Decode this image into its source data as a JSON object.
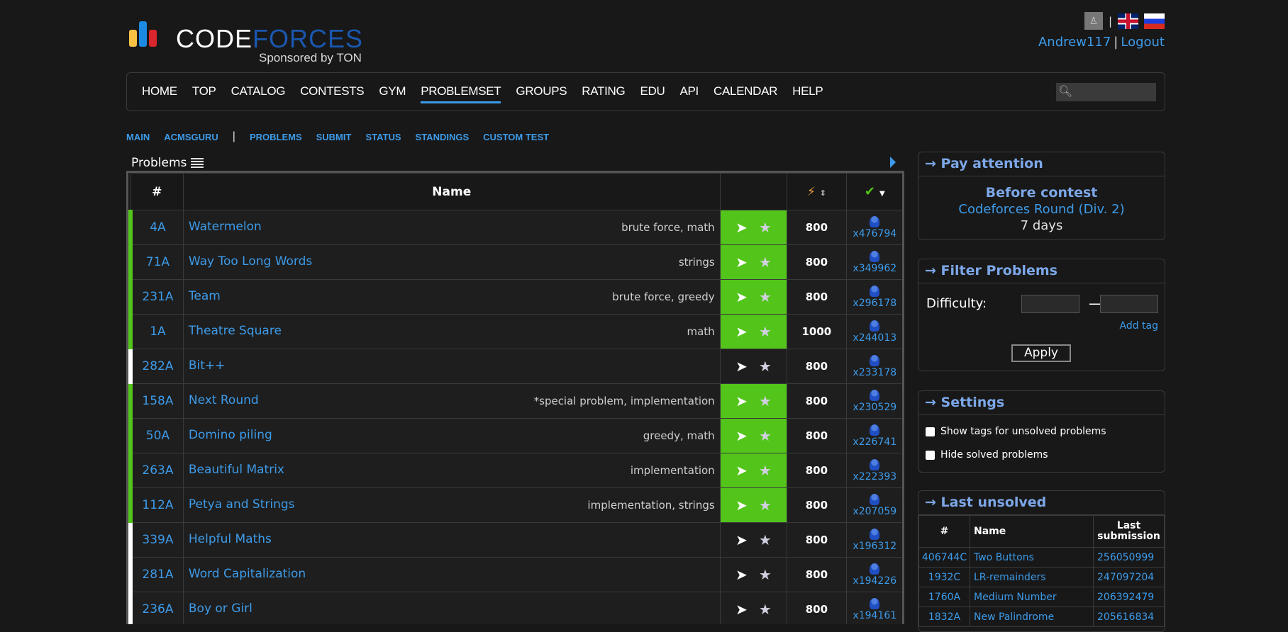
{
  "header": {
    "logo_word1": "CODE",
    "logo_word2": "FORCES",
    "logo_sub": "Sponsored by TON",
    "username": "Andrew117",
    "logout": "Logout",
    "lang_sep": "|",
    "user_sep": "|"
  },
  "nav": {
    "items": [
      "HOME",
      "TOP",
      "CATALOG",
      "CONTESTS",
      "GYM",
      "PROBLEMSET",
      "GROUPS",
      "RATING",
      "EDU",
      "API",
      "CALENDAR",
      "HELP"
    ],
    "active": "PROBLEMSET"
  },
  "subnav": {
    "left": [
      "MAIN",
      "ACMSGURU"
    ],
    "sep": "|",
    "right": [
      "PROBLEMS",
      "SUBMIT",
      "STATUS",
      "STANDINGS",
      "CUSTOM TEST"
    ]
  },
  "problems": {
    "title": "Problems",
    "col_id": "#",
    "col_name": "Name",
    "rows": [
      {
        "id": "4A",
        "name": "Watermelon",
        "tags": "brute force, math",
        "diff": "800",
        "count": "x476794",
        "solved": true
      },
      {
        "id": "71A",
        "name": "Way Too Long Words",
        "tags": "strings",
        "diff": "800",
        "count": "x349962",
        "solved": true
      },
      {
        "id": "231A",
        "name": "Team",
        "tags": "brute force, greedy",
        "diff": "800",
        "count": "x296178",
        "solved": true
      },
      {
        "id": "1A",
        "name": "Theatre Square",
        "tags": "math",
        "diff": "1000",
        "count": "x244013",
        "solved": true
      },
      {
        "id": "282A",
        "name": "Bit++",
        "tags": "",
        "diff": "800",
        "count": "x233178",
        "solved": false
      },
      {
        "id": "158A",
        "name": "Next Round",
        "tags": "*special problem, implementation",
        "diff": "800",
        "count": "x230529",
        "solved": true
      },
      {
        "id": "50A",
        "name": "Domino piling",
        "tags": "greedy, math",
        "diff": "800",
        "count": "x226741",
        "solved": true
      },
      {
        "id": "263A",
        "name": "Beautiful Matrix",
        "tags": "implementation",
        "diff": "800",
        "count": "x222393",
        "solved": true
      },
      {
        "id": "112A",
        "name": "Petya and Strings",
        "tags": "implementation, strings",
        "diff": "800",
        "count": "x207059",
        "solved": true
      },
      {
        "id": "339A",
        "name": "Helpful Maths",
        "tags": "",
        "diff": "800",
        "count": "x196312",
        "solved": false
      },
      {
        "id": "281A",
        "name": "Word Capitalization",
        "tags": "",
        "diff": "800",
        "count": "x194226",
        "solved": false
      },
      {
        "id": "236A",
        "name": "Boy or Girl",
        "tags": "",
        "diff": "800",
        "count": "x194161",
        "solved": false
      }
    ]
  },
  "pay_attention": {
    "title": "→ Pay attention",
    "line1": "Before contest",
    "line2": "Codeforces Round (Div. 2)",
    "line3": "7 days"
  },
  "filter": {
    "title": "→ Filter Problems",
    "difficulty_label": "Difficulty:",
    "dash": "—",
    "add_tag": "Add tag",
    "apply": "Apply"
  },
  "settings": {
    "title": "→ Settings",
    "opt1": "Show tags for unsolved problems",
    "opt2": "Hide solved problems"
  },
  "last_unsolved": {
    "title": "→ Last unsolved",
    "col_id": "#",
    "col_name": "Name",
    "col_last": "Last submission",
    "rows": [
      {
        "id": "406744C",
        "name": "Two Buttons",
        "sub": "256050999"
      },
      {
        "id": "1932C",
        "name": "LR-remainders",
        "sub": "247097204"
      },
      {
        "id": "1760A",
        "name": "Medium Number",
        "sub": "206392479"
      },
      {
        "id": "1832A",
        "name": "New Palindrome",
        "sub": "205616834"
      }
    ]
  },
  "colors": {
    "accent": "#3d9be9",
    "solved": "#52c41a",
    "sidebar_title": "#7ca7e8"
  }
}
